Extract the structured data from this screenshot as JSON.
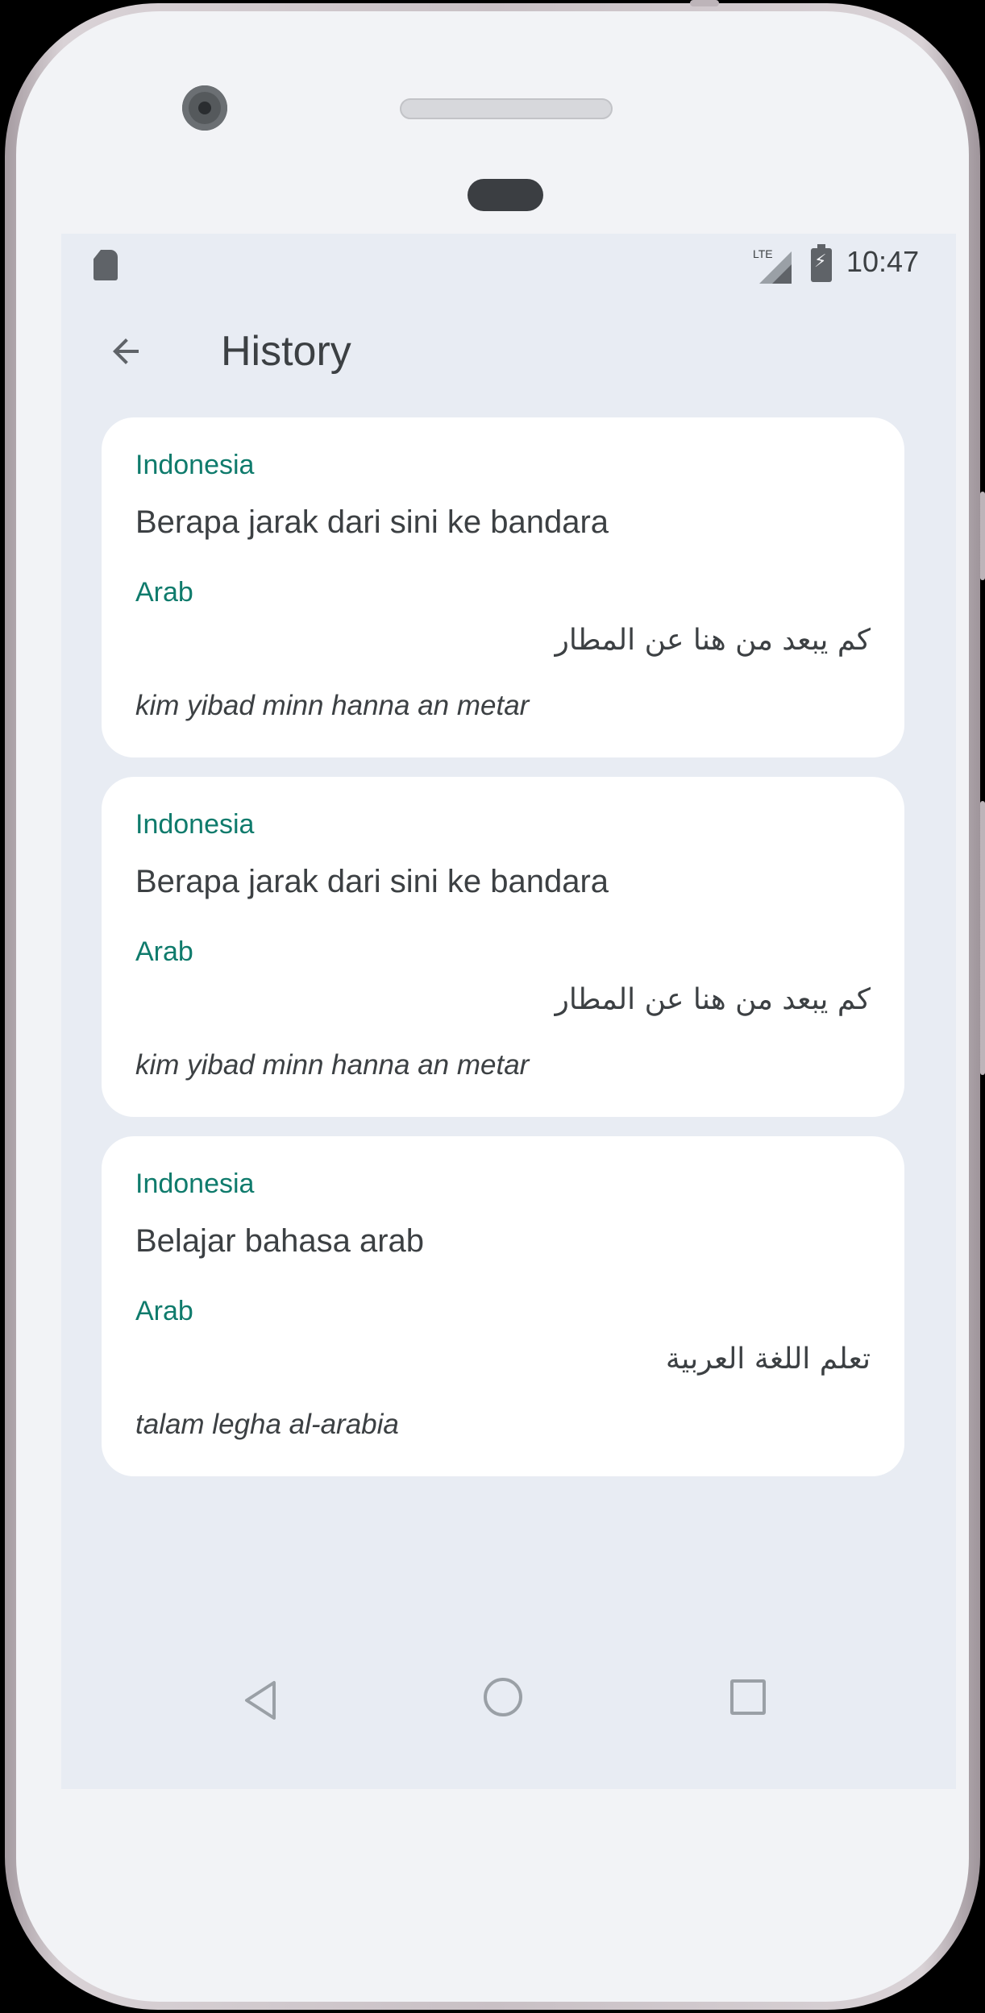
{
  "status_bar": {
    "time": "10:47",
    "network": "LTE",
    "icons": [
      "sd-card-icon",
      "lte-signal-icon",
      "battery-charging-icon"
    ]
  },
  "app_bar": {
    "back_icon": "arrow-left-icon",
    "title": "History"
  },
  "history": [
    {
      "source_lang": "Indonesia",
      "source_text": "Berapa jarak dari sini ke bandara",
      "target_lang": "Arab",
      "target_text": "كم يبعد من هنا عن المطار",
      "transliteration": "kim yibad minn hanna an metar"
    },
    {
      "source_lang": "Indonesia",
      "source_text": "Berapa jarak dari sini ke bandara",
      "target_lang": "Arab",
      "target_text": "كم يبعد من هنا عن المطار",
      "transliteration": "kim yibad minn hanna an metar"
    },
    {
      "source_lang": "Indonesia",
      "source_text": "Belajar bahasa arab",
      "target_lang": "Arab",
      "target_text": "تعلم اللغة العربية",
      "transliteration": "talam legha al-arabia"
    }
  ],
  "nav_bar": {
    "icons": [
      "nav-back-icon",
      "nav-home-icon",
      "nav-recents-icon"
    ]
  },
  "colors": {
    "accent": "#0f7b6c",
    "background": "#e8ecf3",
    "card": "#ffffff",
    "text": "#3c4043"
  }
}
